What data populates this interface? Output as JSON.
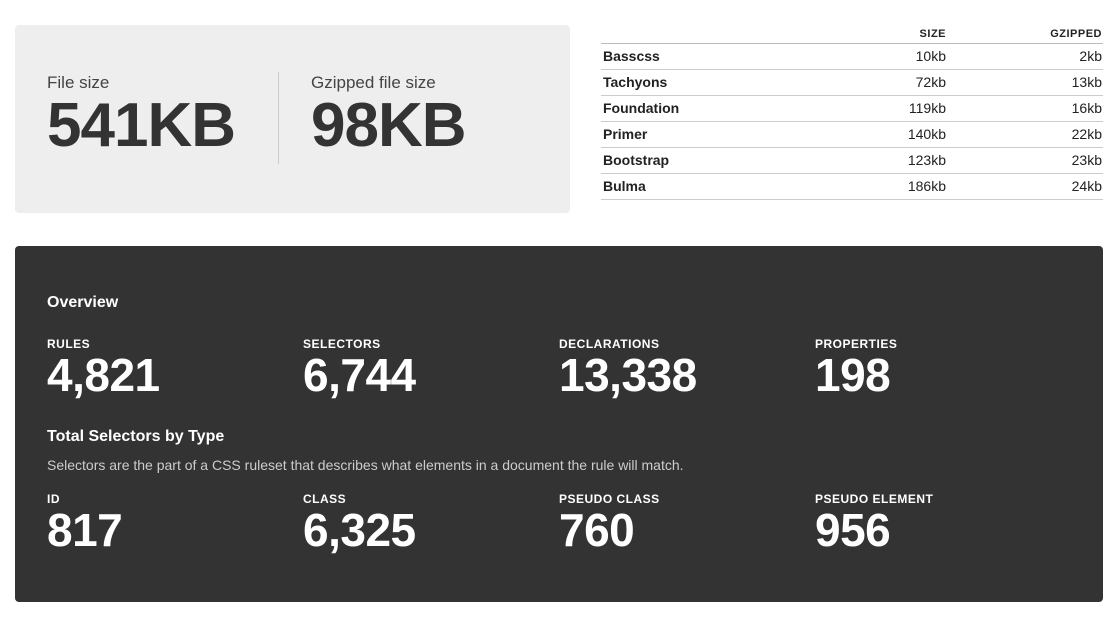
{
  "filesize": {
    "file_size_label": "File size",
    "file_size_value": "541KB",
    "gzipped_label": "Gzipped file size",
    "gzipped_value": "98KB"
  },
  "comparison": {
    "headers": {
      "name": "",
      "size": "SIZE",
      "gzipped": "GZIPPED"
    },
    "rows": [
      {
        "name": "Basscss",
        "size": "10kb",
        "gzipped": "2kb"
      },
      {
        "name": "Tachyons",
        "size": "72kb",
        "gzipped": "13kb"
      },
      {
        "name": "Foundation",
        "size": "119kb",
        "gzipped": "16kb"
      },
      {
        "name": "Primer",
        "size": "140kb",
        "gzipped": "22kb"
      },
      {
        "name": "Bootstrap",
        "size": "123kb",
        "gzipped": "23kb"
      },
      {
        "name": "Bulma",
        "size": "186kb",
        "gzipped": "24kb"
      }
    ]
  },
  "overview": {
    "heading": "Overview",
    "stats": [
      {
        "label": "RULES",
        "value": "4,821"
      },
      {
        "label": "SELECTORS",
        "value": "6,744"
      },
      {
        "label": "DECLARATIONS",
        "value": "13,338"
      },
      {
        "label": "PROPERTIES",
        "value": "198"
      }
    ]
  },
  "selectors_by_type": {
    "heading": "Total Selectors by Type",
    "description": "Selectors are the part of a CSS ruleset that describes what elements in a document the rule will match.",
    "stats": [
      {
        "label": "ID",
        "value": "817"
      },
      {
        "label": "CLASS",
        "value": "6,325"
      },
      {
        "label": "PSEUDO CLASS",
        "value": "760"
      },
      {
        "label": "PSEUDO ELEMENT",
        "value": "956"
      }
    ]
  },
  "colors": {
    "dark_panel": "#333333",
    "light_panel": "#eeeeee"
  }
}
